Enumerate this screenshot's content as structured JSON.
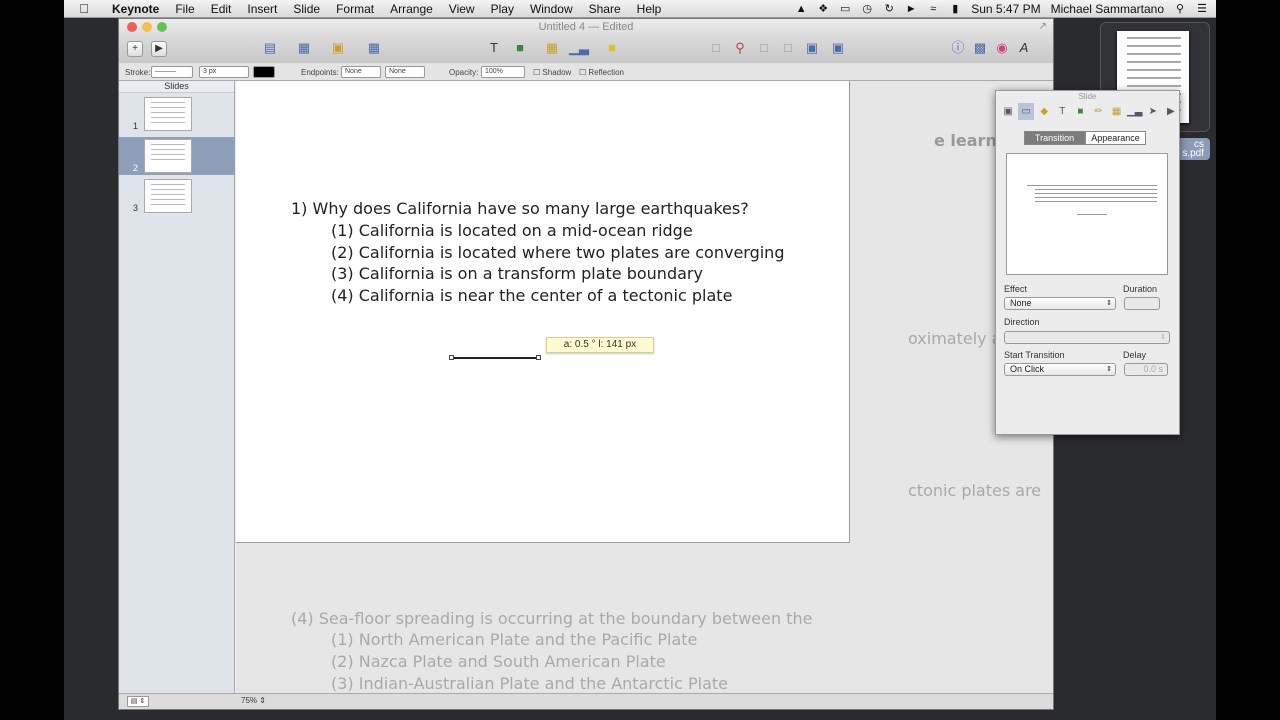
{
  "menubar": {
    "app": "Keynote",
    "items": [
      "File",
      "Edit",
      "Insert",
      "Slide",
      "Format",
      "Arrange",
      "View",
      "Play",
      "Window",
      "Share",
      "Help"
    ],
    "clock": "Sun 5:47 PM",
    "user": "Michael Sammartano"
  },
  "desktop": {
    "file_label_line1": "cs",
    "file_label_line2": "s.pdf"
  },
  "window": {
    "title": "Untitled 4",
    "subtitle": "— Edited"
  },
  "formatbar": {
    "stroke_label": "Stroke:",
    "stroke_width": "3 px",
    "endpoints_label": "Endpoints:",
    "endpoint_start": "None",
    "endpoint_end": "None",
    "opacity_label": "Opacity:",
    "opacity_value": "100%",
    "shadow_label": "Shadow",
    "reflection_label": "Reflection",
    "stroke_color": "#000000"
  },
  "navigator": {
    "header": "Slides",
    "slides": [
      "1",
      "2",
      "3"
    ],
    "selected": 2
  },
  "slide": {
    "question": "1)  Why does California have so many large earthquakes?",
    "choices": [
      "(1)  California is located on a mid-ocean ridge",
      "(2)  California is located where two plates are converging",
      "(3)  California is on a transform plate boundary",
      "(4)  California is near the center of a tectonic plate"
    ],
    "tooltip": "a: 0.5 °    l: 141 px"
  },
  "ghost": {
    "right1": "e learn",
    "right2": "oximately a",
    "right3": "ctonic plates are",
    "question": "(4) Sea-floor spreading is occurring at the boundary between the",
    "choices": [
      "(1)  North American Plate and the Pacific Plate",
      "(2)  Nazca Plate and South American Plate",
      "(3)  Indian-Australian Plate and the Antarctic Plate"
    ]
  },
  "bottombar": {
    "zoom": "75%"
  },
  "inspector": {
    "title": "Slide",
    "tab_transition": "Transition",
    "tab_appearance": "Appearance",
    "effect_label": "Effect",
    "effect_value": "None",
    "duration_label": "Duration",
    "direction_label": "Direction",
    "start_label": "Start Transition",
    "start_value": "On Click",
    "delay_label": "Delay",
    "delay_value": "0.0 s"
  }
}
